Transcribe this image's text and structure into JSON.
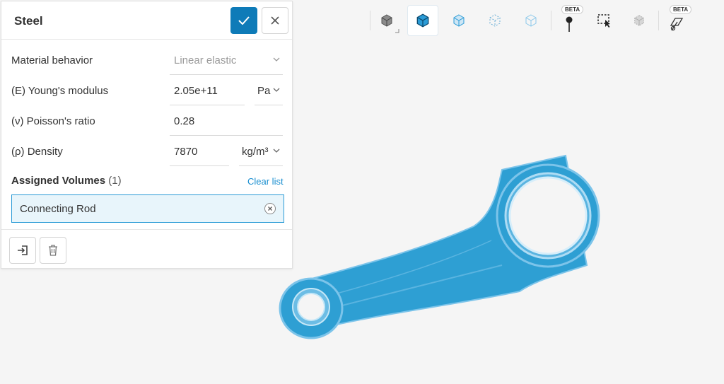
{
  "panel": {
    "title": "Steel",
    "properties": [
      {
        "label": "Material behavior",
        "value": "Linear elastic"
      },
      {
        "label": "(E) Young's modulus",
        "value": "2.05e+11",
        "unit": "Pa"
      },
      {
        "label": "(ν) Poisson's ratio",
        "value": "0.28"
      },
      {
        "label": "(ρ) Density",
        "value": "7870",
        "unit": "kg/m³"
      }
    ],
    "assigned": {
      "label": "Assigned Volumes",
      "count": "(1)",
      "clear_label": "Clear list",
      "items": [
        "Connecting Rod"
      ]
    }
  },
  "toolbar": {
    "beta_label": "BETA",
    "tools": [
      "solid-view-icon",
      "solid-edges-view-icon",
      "transparent-view-icon",
      "wireframe-view-icon",
      "outline-view-icon",
      "point-probe-icon",
      "box-select-icon",
      "hide-selection-icon",
      "section-cut-icon"
    ]
  },
  "colors": {
    "accent": "#0e7bb8",
    "model": "#2a9bd6",
    "selection_bg": "#e8f5fb"
  }
}
